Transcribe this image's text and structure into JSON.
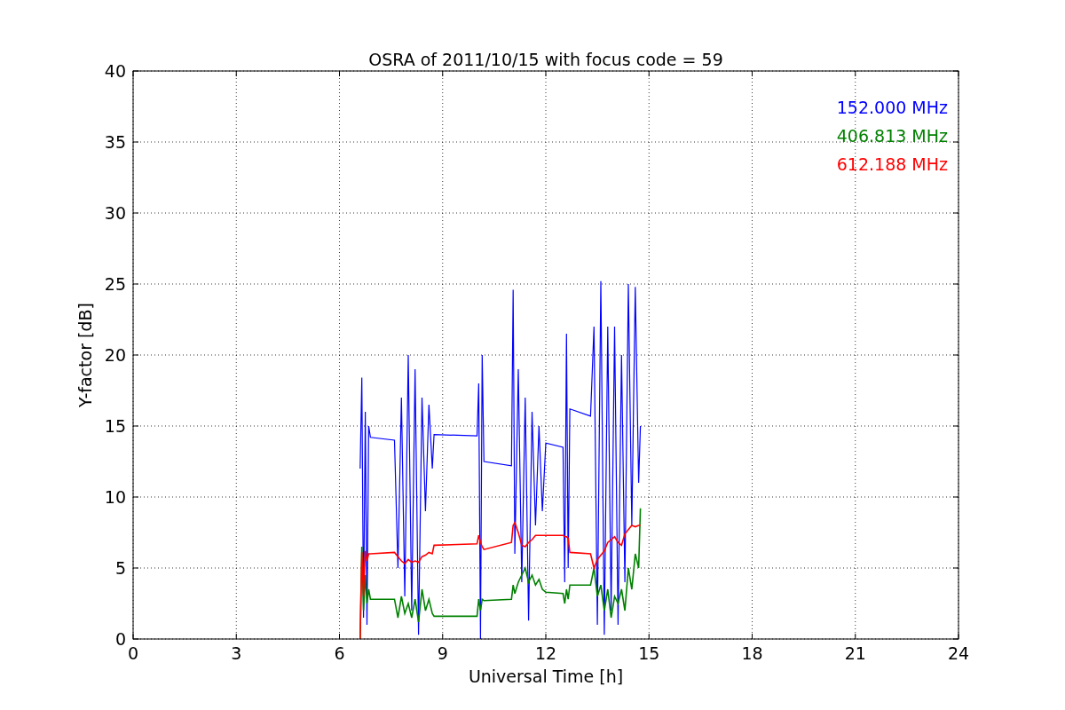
{
  "chart_data": {
    "type": "line",
    "title": "OSRA of 2011/10/15 with focus code = 59",
    "xlabel": "Universal Time [h]",
    "ylabel": "Y-factor [dB]",
    "x": [
      6.6,
      6.65,
      6.7,
      6.75,
      6.8,
      6.85,
      6.9,
      7.6,
      7.7,
      7.8,
      7.9,
      8.0,
      8.1,
      8.2,
      8.3,
      8.4,
      8.5,
      8.6,
      8.7,
      8.75,
      10.0,
      10.05,
      10.1,
      10.15,
      10.2,
      11.0,
      11.05,
      11.1,
      11.2,
      11.3,
      11.4,
      11.5,
      11.6,
      11.7,
      11.8,
      11.9,
      12.0,
      12.5,
      12.55,
      12.6,
      12.65,
      12.7,
      13.3,
      13.4,
      13.5,
      13.6,
      13.7,
      13.8,
      13.9,
      14.0,
      14.1,
      14.2,
      14.3,
      14.4,
      14.5,
      14.6,
      14.7,
      14.75
    ],
    "series": [
      {
        "name": "152.000 MHz",
        "color": "#0000ff",
        "values": [
          12,
          18.4,
          1.5,
          16,
          1,
          15,
          14.2,
          14,
          5,
          17,
          3,
          20,
          2,
          19,
          0.3,
          17,
          9,
          16.5,
          12,
          14.4,
          14.3,
          18,
          0,
          20,
          12.5,
          12.2,
          24.6,
          6,
          19,
          4,
          17,
          1.3,
          16,
          8,
          15,
          9,
          13.8,
          13.5,
          4,
          21.5,
          5,
          16.2,
          15.7,
          22,
          1,
          25.2,
          0.3,
          22,
          2,
          22,
          1,
          20,
          4,
          25,
          8,
          24.8,
          11,
          15
        ]
      },
      {
        "name": "406.813 MHz",
        "color": "#008000",
        "values": [
          0,
          6.5,
          2,
          4.5,
          2.5,
          3.5,
          2.8,
          2.8,
          1.5,
          3,
          1.8,
          2.5,
          1.5,
          2.8,
          1.2,
          3.5,
          2,
          2.8,
          1.8,
          1.6,
          1.6,
          2.8,
          2,
          2.8,
          2.7,
          2.8,
          3.8,
          3.2,
          4,
          4.5,
          5,
          4,
          4.5,
          3.8,
          4.2,
          3.5,
          3.3,
          3.2,
          2.5,
          3.5,
          2.8,
          3.8,
          3.8,
          5,
          3,
          3.8,
          2,
          3.5,
          1.5,
          3,
          2.5,
          3.5,
          2,
          5,
          3.5,
          6,
          5,
          9.2
        ]
      },
      {
        "name": "612.188 MHz",
        "color": "#ff0000",
        "values": [
          0,
          6.1,
          3,
          6.2,
          5.5,
          6,
          6,
          6.1,
          5.8,
          5.5,
          5.3,
          5.6,
          5.4,
          5.5,
          5.4,
          5.8,
          5.9,
          6.1,
          6,
          6.6,
          6.7,
          7.3,
          6.8,
          6.5,
          6.3,
          6.8,
          8,
          8.2,
          7.5,
          6.6,
          6.5,
          6.8,
          7,
          7.3,
          7.3,
          7.3,
          7.3,
          7.3,
          7.2,
          7.2,
          7.1,
          6.1,
          6,
          5,
          5.6,
          5.9,
          6.2,
          6.8,
          7,
          7.2,
          6.8,
          6.6,
          7.4,
          7.7,
          8,
          7.9,
          8,
          8
        ]
      }
    ],
    "xlim": [
      0,
      24
    ],
    "ylim": [
      0,
      40
    ],
    "xticks": [
      0,
      3,
      6,
      9,
      12,
      15,
      18,
      21,
      24
    ],
    "yticks": [
      0,
      5,
      10,
      15,
      20,
      25,
      30,
      35,
      40
    ],
    "grid": true
  }
}
